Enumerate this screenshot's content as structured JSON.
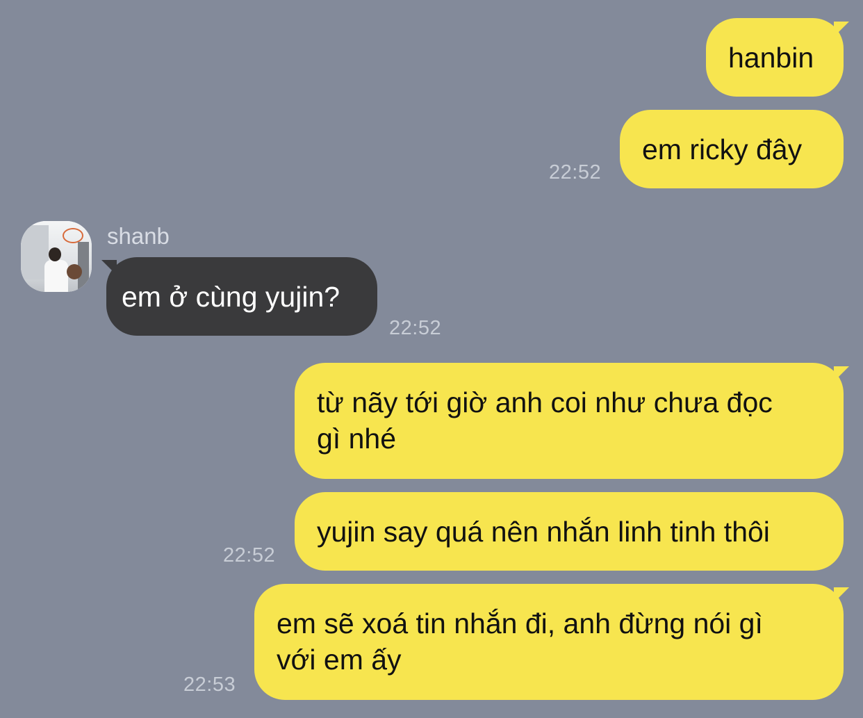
{
  "contact": {
    "name": "shanb",
    "avatar_icon": "contact-avatar-photo"
  },
  "colors": {
    "background": "#838a9a",
    "outgoing_bubble": "#f7e54f",
    "incoming_bubble": "#3a3a3c",
    "timestamp": "#c8cdd6"
  },
  "messages": [
    {
      "direction": "outgoing",
      "text": "hanbin"
    },
    {
      "direction": "outgoing",
      "text": "em ricky đây",
      "time": "22:52"
    },
    {
      "direction": "incoming",
      "sender": "shanb",
      "text": "em ở cùng yujin?",
      "time": "22:52"
    },
    {
      "direction": "outgoing",
      "text_lines": [
        "từ nãy tới giờ anh coi như chưa đọc",
        "gì nhé"
      ]
    },
    {
      "direction": "outgoing",
      "text": "yujin say quá nên nhắn linh tinh thôi",
      "time": "22:52"
    },
    {
      "direction": "outgoing",
      "text_lines": [
        "em sẽ xoá tin nhắn đi, anh đừng nói gì",
        "với em ấy"
      ],
      "time": "22:53"
    }
  ]
}
